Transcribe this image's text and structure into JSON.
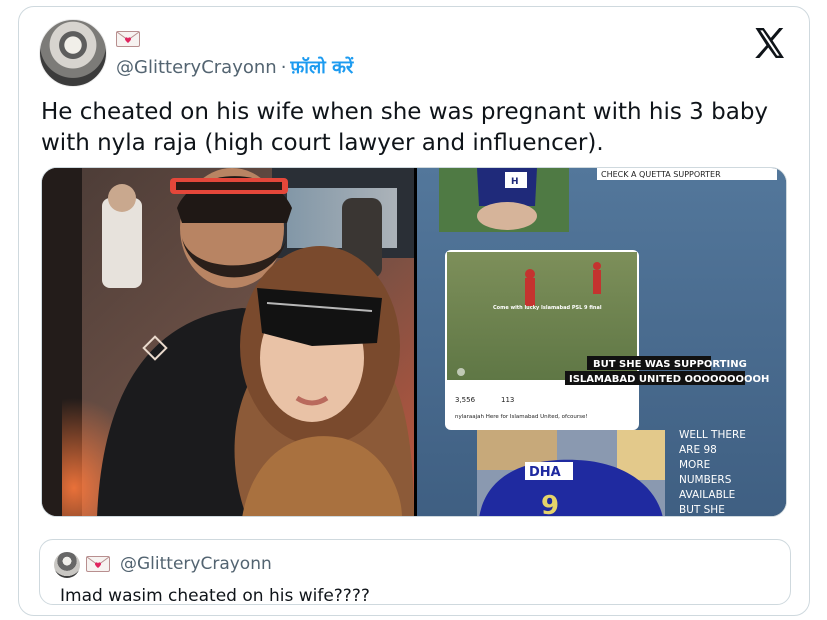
{
  "author": {
    "handle": "@GlitteryCrayonn",
    "separator": "·",
    "follow_label": "फ़ॉलो करें",
    "badge_icon": "love-letter-icon",
    "avatar_icon": "profile-avatar"
  },
  "header": {
    "brand_icon": "x-logo-icon"
  },
  "tweet": {
    "text": "He cheated on his wife when she was pregnant with his 3 baby with nyla raja (high court lawyer and influencer)."
  },
  "media": {
    "left": {
      "description_icon": "selfie-photo"
    },
    "right": {
      "top_caption": "CHECK A QUETTA SUPPORTER",
      "match_caption": "Come with lucky Islamabad PSL 9 final",
      "banner_line1": "BUT SHE WAS SUPPORTING",
      "banner_line2": "ISLAMABAD UNITED OOOOOOOOOH",
      "likes": "3,556",
      "comments": "113",
      "post_caption": "nylaraajah Here for Islamabad United, ofcourse!",
      "side_lines": [
        "WELL THERE",
        "ARE 98",
        "MORE",
        "NUMBERS",
        "AVAILABLE",
        "BUT SHE"
      ],
      "shirt_text": "DHA"
    }
  },
  "quoted": {
    "handle": "@GlitteryCrayonn",
    "text": "Imad wasim cheated on his wife????"
  }
}
